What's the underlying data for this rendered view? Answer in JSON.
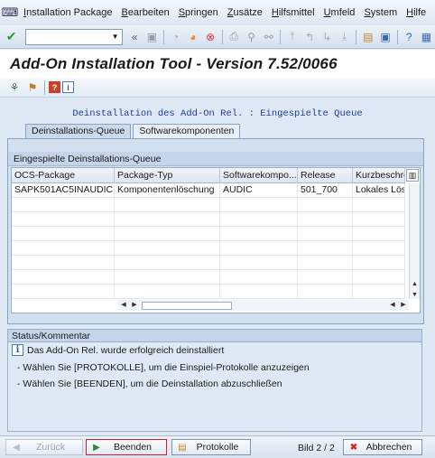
{
  "menubar": {
    "items": [
      "Installation Package",
      "Bearbeiten",
      "Springen",
      "Zusätze",
      "Hilfsmittel",
      "Umfeld",
      "System",
      "Hilfe"
    ]
  },
  "toolbar": {
    "command_value": "",
    "icons": [
      "check-icon",
      "back-icon",
      "save-icon",
      "back-nav-icon",
      "exit-icon",
      "cancel-icon",
      "print-icon",
      "find-icon",
      "find-next-icon",
      "first-page-icon",
      "prev-page-icon",
      "next-page-icon",
      "last-page-icon",
      "new-session-icon",
      "shortcut-icon",
      "help-icon",
      "customize-icon"
    ]
  },
  "title": "Add-On Installation Tool - Version 7.52/0066",
  "apptoolbar": {
    "icons": [
      "tree-icon",
      "package-icon",
      "help-book-icon",
      "info-icon"
    ]
  },
  "main": {
    "heading": "Deinstallation des Add-On Rel. : Eingespielte Queue",
    "tabs": [
      {
        "label": "Deinstallations-Queue",
        "active": true
      },
      {
        "label": "Softwarekomponenten",
        "active": false
      }
    ],
    "group_title": "Eingespielte Deinstallations-Queue",
    "columns": [
      "OCS-Package",
      "Package-Typ",
      "Softwarekompo...",
      "Release",
      "Kurzbeschre"
    ],
    "rows": [
      [
        "SAPK501AC5INAUDIC",
        "Komponentenlöschung",
        "AUDIC",
        "501_700",
        "Lokales Lösc"
      ]
    ],
    "empty_rows": 7
  },
  "status": {
    "title": "Status/Kommentar",
    "message": "Das Add-On Rel. wurde erfolgreich deinstalliert",
    "hint1": "- Wählen Sie [PROTOKOLLE], um die Einspiel-Protokolle anzuzeigen",
    "hint2": "- Wählen Sie [BEENDEN], um die Deinstallation abzuschließen"
  },
  "bottom": {
    "back_label": "Zurück",
    "finish_label": "Beenden",
    "logs_label": "Protokolle",
    "page_info": "Bild 2 / 2",
    "cancel_label": "Abbrechen"
  }
}
